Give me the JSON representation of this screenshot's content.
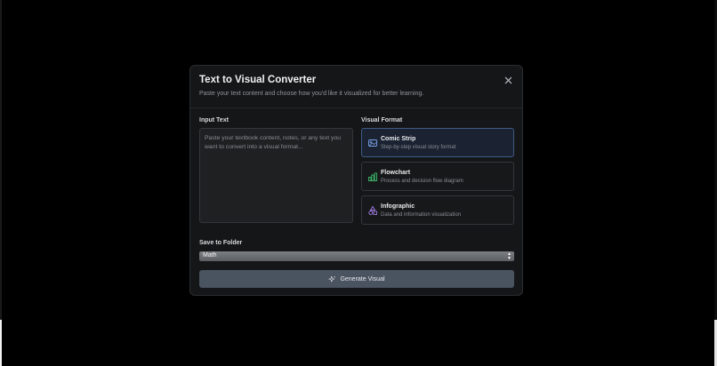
{
  "modal": {
    "title": "Text to Visual Converter",
    "subtitle": "Paste your text content and choose how you'd like it visualized for better learning."
  },
  "input": {
    "label": "Input Text",
    "placeholder": "Paste your textbook content, notes, or any text you want to convert into a visual format..."
  },
  "visual_format": {
    "label": "Visual Format",
    "options": [
      {
        "title": "Comic Strip",
        "description": "Step-by-step visual story format",
        "icon": "image-icon",
        "selected": true,
        "icon_color": "#7aa2e6"
      },
      {
        "title": "Flowchart",
        "description": "Process and decision flow diagram",
        "icon": "bar-chart-icon",
        "selected": false,
        "icon_color": "#3fbf6f"
      },
      {
        "title": "Infographic",
        "description": "Data and information visualization",
        "icon": "shapes-icon",
        "selected": false,
        "icon_color": "#a07be0"
      }
    ]
  },
  "folder": {
    "label": "Save to Folder",
    "selected": "Math"
  },
  "generate": {
    "label": "Generate Visual",
    "icon": "sparkles-icon"
  },
  "colors": {
    "background": "#000000",
    "modal": "#151617",
    "selected_card": "#1b2333",
    "button": "#4a5360"
  }
}
